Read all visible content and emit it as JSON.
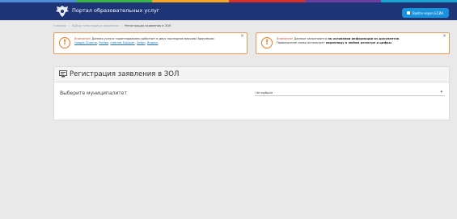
{
  "colors": {
    "header_bg": "#1d3577",
    "accent": "#1a92db",
    "warning": "#f27a22",
    "page_bg": "#e9e9e9"
  },
  "header": {
    "title": "Портал образовательных услуг",
    "login_button": "Войти через ЕСИА",
    "logo_icon": "eagle-emblem-icon"
  },
  "breadcrumbs": {
    "items": [
      "Главная",
      "Выбор типа подачи заявления"
    ],
    "current": "Регистрация заявления в ЗОЛ"
  },
  "alerts": [
    {
      "lead": "Внимание!",
      "line1": " Данная услуга гарантированно работает в двух последних версиях браузеров:",
      "links": [
        "Google Chrome",
        "Firefox",
        "Internet Explorer",
        "Safari",
        "Яндекс"
      ]
    },
    {
      "lead": "Внимание!",
      "line1_pre": " Данные заполняются ",
      "line1_bold": "на основании информации из документов",
      "line1_post": ".",
      "line2_pre": "Проверочное слово использует ",
      "line2_bold": "кириллицу в любом регистре и цифры",
      "line2_post": "."
    }
  ],
  "card": {
    "title": "Регистрация заявления в ЗОЛ",
    "field_label": "Выберите муниципалитет",
    "select_value": "Не выбран"
  }
}
